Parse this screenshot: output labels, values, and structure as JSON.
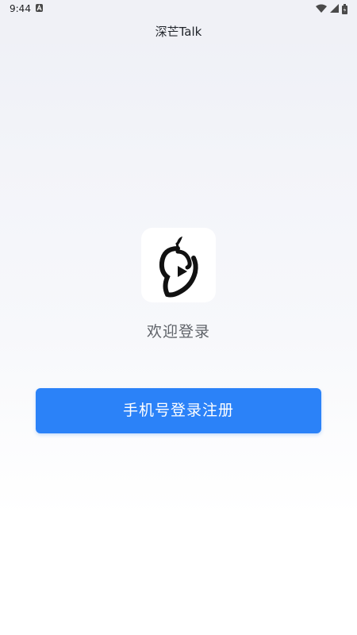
{
  "status_bar": {
    "time": "9:44",
    "notification_icon": "a-notification-icon",
    "wifi_icon": "wifi-icon",
    "signal_icon": "cell-signal-icon",
    "battery_icon": "battery-icon"
  },
  "app_bar": {
    "title": "深芒Talk"
  },
  "main": {
    "logo_icon": "mango-logo-icon",
    "welcome_text": "欢迎登录",
    "phone_login_button": "手机号登录注册"
  },
  "colors": {
    "accent": "#2b82f8",
    "background_top": "#eef0f6",
    "background_bottom": "#ffffff",
    "welcome_text": "#5f6369"
  }
}
